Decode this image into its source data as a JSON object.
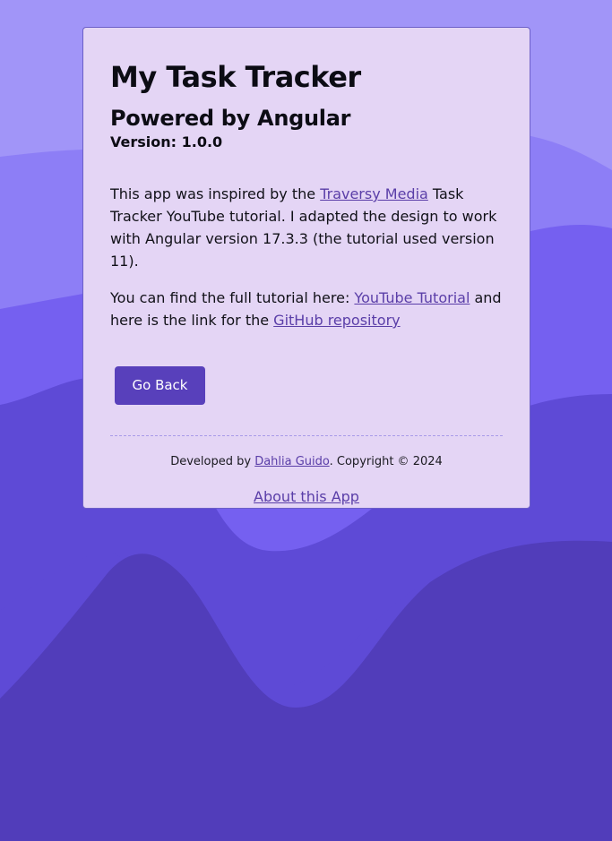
{
  "background_colors": {
    "base": "#a195f8",
    "wave1": "#8d7ef6",
    "wave2": "#7560f0",
    "wave3": "#5e4ad6",
    "wave4": "#513dba"
  },
  "card": {
    "title": "My Task Tracker",
    "subtitle": "Powered by Angular",
    "version": "Version: 1.0.0",
    "paragraph1": {
      "before_link": "This app was inspired by the ",
      "link": "Traversy Media",
      "after_link": " Task Tracker YouTube tutorial. I adapted the design to work with Angular version 17.3.3 (the tutorial used version 11)."
    },
    "paragraph2": {
      "before_link1": "You can find the full tutorial here: ",
      "link1": "YouTube Tutorial",
      "between_links": " and here is the link for the ",
      "link2": "GitHub repository"
    },
    "back_button": "Go Back"
  },
  "footer": {
    "developed_by": "Developed by ",
    "author_link": "Dahlia Guido",
    "copyright": ". Copyright © 2024",
    "about_link": "About this App"
  },
  "colors": {
    "card_bg": "#e4d5f5",
    "button_bg": "#5840bb",
    "link": "#5a3ea8"
  }
}
